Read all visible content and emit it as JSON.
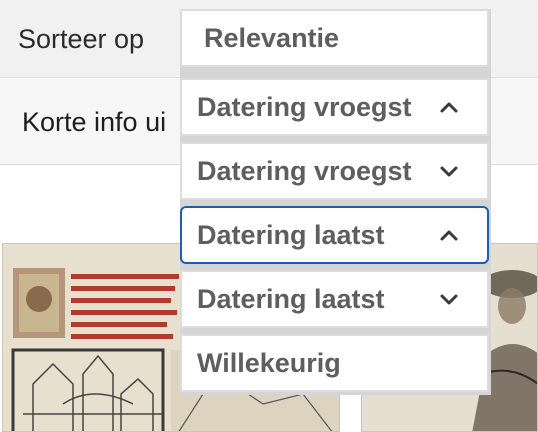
{
  "sort": {
    "label": "Sorteer op",
    "options": [
      {
        "label": "Relevantie",
        "icon": "none"
      },
      {
        "label": "Datering vroegst",
        "icon": "chevron-up-icon"
      },
      {
        "label": "Datering vroegst",
        "icon": "chevron-down-icon"
      },
      {
        "label": "Datering laatst",
        "icon": "chevron-up-icon",
        "highlighted": true
      },
      {
        "label": "Datering laatst",
        "icon": "chevron-down-icon"
      },
      {
        "label": "Willekeurig",
        "icon": "none"
      }
    ]
  },
  "info": {
    "label": "Korte info ui"
  },
  "colors": {
    "focus_border": "#1a5fb4",
    "option_text": "#5e5e5e",
    "bar_background": "#f1f1f1"
  }
}
